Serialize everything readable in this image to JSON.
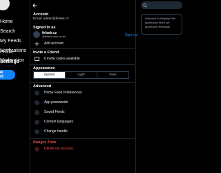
{
  "nav": {
    "items": [
      {
        "label": "Home"
      },
      {
        "label": "Search"
      },
      {
        "label": "My Feeds"
      },
      {
        "label": "Notifications"
      },
      {
        "label": "Moderation"
      },
      {
        "label": "Profile"
      },
      {
        "label": "Settings"
      }
    ],
    "new_post_label": "New Post"
  },
  "header": {
    "back_icon": "arrow-left-icon"
  },
  "account": {
    "title": "Account",
    "email": "Email: admin@fefaek.cz"
  },
  "signed_in": {
    "title": "Signed in as",
    "display_name": "fefaek.cz",
    "handle": "@fefaek.bsky.social",
    "sign_out": "Sign out",
    "add_account": "Add account"
  },
  "invite": {
    "title": "Invite a Friend",
    "codes": "0 invite codes available"
  },
  "appearance": {
    "title": "Appearance",
    "options": [
      "System",
      "Light",
      "Dark"
    ],
    "selected": "System"
  },
  "advanced": {
    "title": "Advanced",
    "items": [
      "Home Feed Preferences",
      "App passwords",
      "Saved Feeds",
      "Content languages",
      "Change handle"
    ]
  },
  "danger": {
    "title": "Danger Zone",
    "delete": "Delete my account..."
  },
  "right": {
    "welcome": "Welcome to Bluesky! We",
    "line2": "appreciate that's wh",
    "line3": "appreciate feedback"
  }
}
